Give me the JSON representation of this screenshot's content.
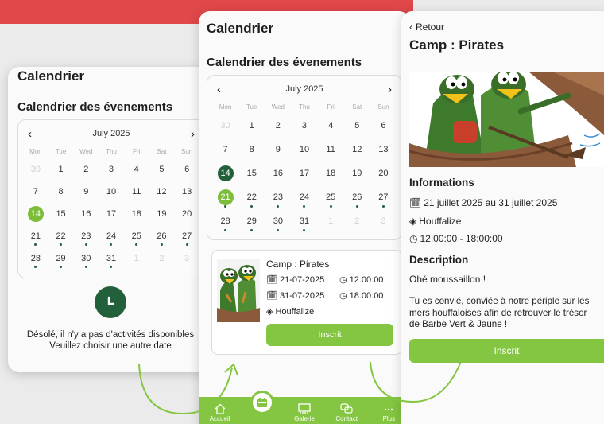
{
  "screen1": {
    "title": "Calendrier",
    "section": "Calendrier des évenements",
    "month": "July 2025",
    "weekdays": [
      "Mon",
      "Tue",
      "Wed",
      "Thu",
      "Fri",
      "Sat",
      "Sun"
    ],
    "days": [
      "30",
      "1",
      "2",
      "3",
      "4",
      "5",
      "6",
      "7",
      "8",
      "9",
      "10",
      "11",
      "12",
      "13",
      "14",
      "15",
      "16",
      "17",
      "18",
      "19",
      "20",
      "21",
      "22",
      "23",
      "24",
      "25",
      "26",
      "27",
      "28",
      "29",
      "30",
      "31",
      "1",
      "2",
      "3"
    ],
    "empty_line1": "Désolé, il n'y a pas d'activités disponibles",
    "empty_line2": "Veuillez choisir une autre date"
  },
  "screen2": {
    "title": "Calendrier",
    "section": "Calendrier des évenements",
    "month": "July 2025",
    "weekdays": [
      "Mon",
      "Tue",
      "Wed",
      "Thu",
      "Fri",
      "Sat",
      "Sun"
    ],
    "days": [
      "30",
      "1",
      "2",
      "3",
      "4",
      "5",
      "6",
      "7",
      "8",
      "9",
      "10",
      "11",
      "12",
      "13",
      "14",
      "15",
      "16",
      "17",
      "18",
      "19",
      "20",
      "21",
      "22",
      "23",
      "24",
      "25",
      "26",
      "27",
      "28",
      "29",
      "30",
      "31",
      "1",
      "2",
      "3"
    ],
    "event": {
      "name": "Camp : Pirates",
      "start_date": "21-07-2025",
      "start_time": "12:00:00",
      "end_date": "31-07-2025",
      "end_time": "18:00:00",
      "location": "Houffalize",
      "button": "Inscrit"
    },
    "tabs": [
      "Accueil",
      "",
      "Galerie",
      "Contact",
      "Plus"
    ]
  },
  "screen3": {
    "back": "Retour",
    "title": "Camp : Pirates",
    "info_heading": "Informations",
    "dates": "21 juillet 2025 au 31 juillet 2025",
    "location": "Houffalize",
    "hours": "12:00:00 - 18:00:00",
    "desc_heading": "Description",
    "desc1": "Ohé moussaillon !",
    "desc2a": "Tu es convié, conviée à notre périple sur les",
    "desc2b": "mers houffaloises afin de retrouver le trésor",
    "desc2c": "de Barbe Vert & Jaune !",
    "button": "Inscrit"
  },
  "colors": {
    "accent": "#84c541",
    "dark_green": "#21603a",
    "red": "#e0484a"
  }
}
